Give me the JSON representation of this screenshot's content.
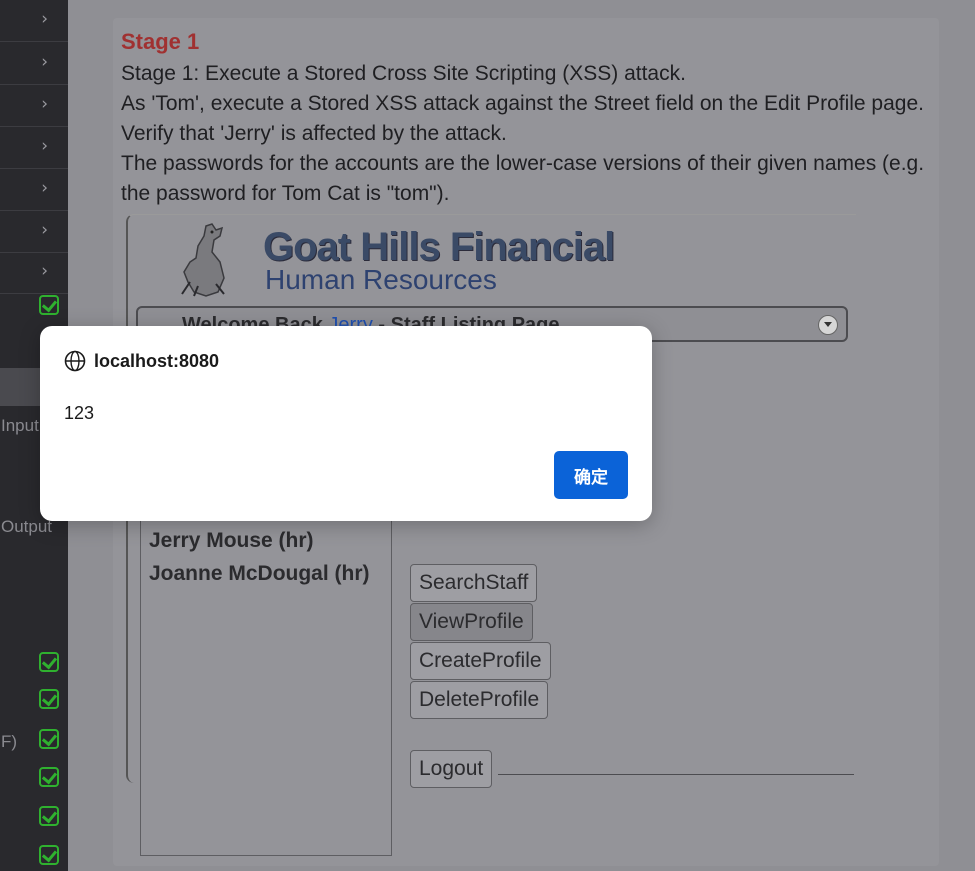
{
  "sidebar": {
    "labels": {
      "input": "Input",
      "output": "Output",
      "partial": "F)"
    }
  },
  "lesson": {
    "stage_title": "Stage 1",
    "description": [
      "Stage 1: Execute a Stored Cross Site Scripting (XSS) attack.",
      "As 'Tom', execute a Stored XSS attack against the Street field on the Edit Profile page. Verify that 'Jerry' is affected by the attack.",
      "The passwords for the accounts are the lower-case versions of their given names (e.g. the password for Tom Cat is \"tom\")."
    ]
  },
  "app": {
    "logo_title": "Goat Hills Financial",
    "logo_subtitle": "Human Resources",
    "welcome_prefix": "Welcome Back ",
    "welcome_user": "Jerry",
    "welcome_suffix": " - Staff Listing Page",
    "staff": [
      "Jerry Mouse (hr)",
      "Joanne McDougal (hr)"
    ],
    "buttons": {
      "search": "SearchStaff",
      "view": "ViewProfile",
      "create": "CreateProfile",
      "delete": "DeleteProfile",
      "logout": "Logout"
    }
  },
  "dialog": {
    "origin": "localhost:8080",
    "message": "123",
    "ok_label": "确定"
  },
  "colors": {
    "accent": "#0b63d8",
    "check": "#2fb12f",
    "stage_title": "#a03131"
  }
}
